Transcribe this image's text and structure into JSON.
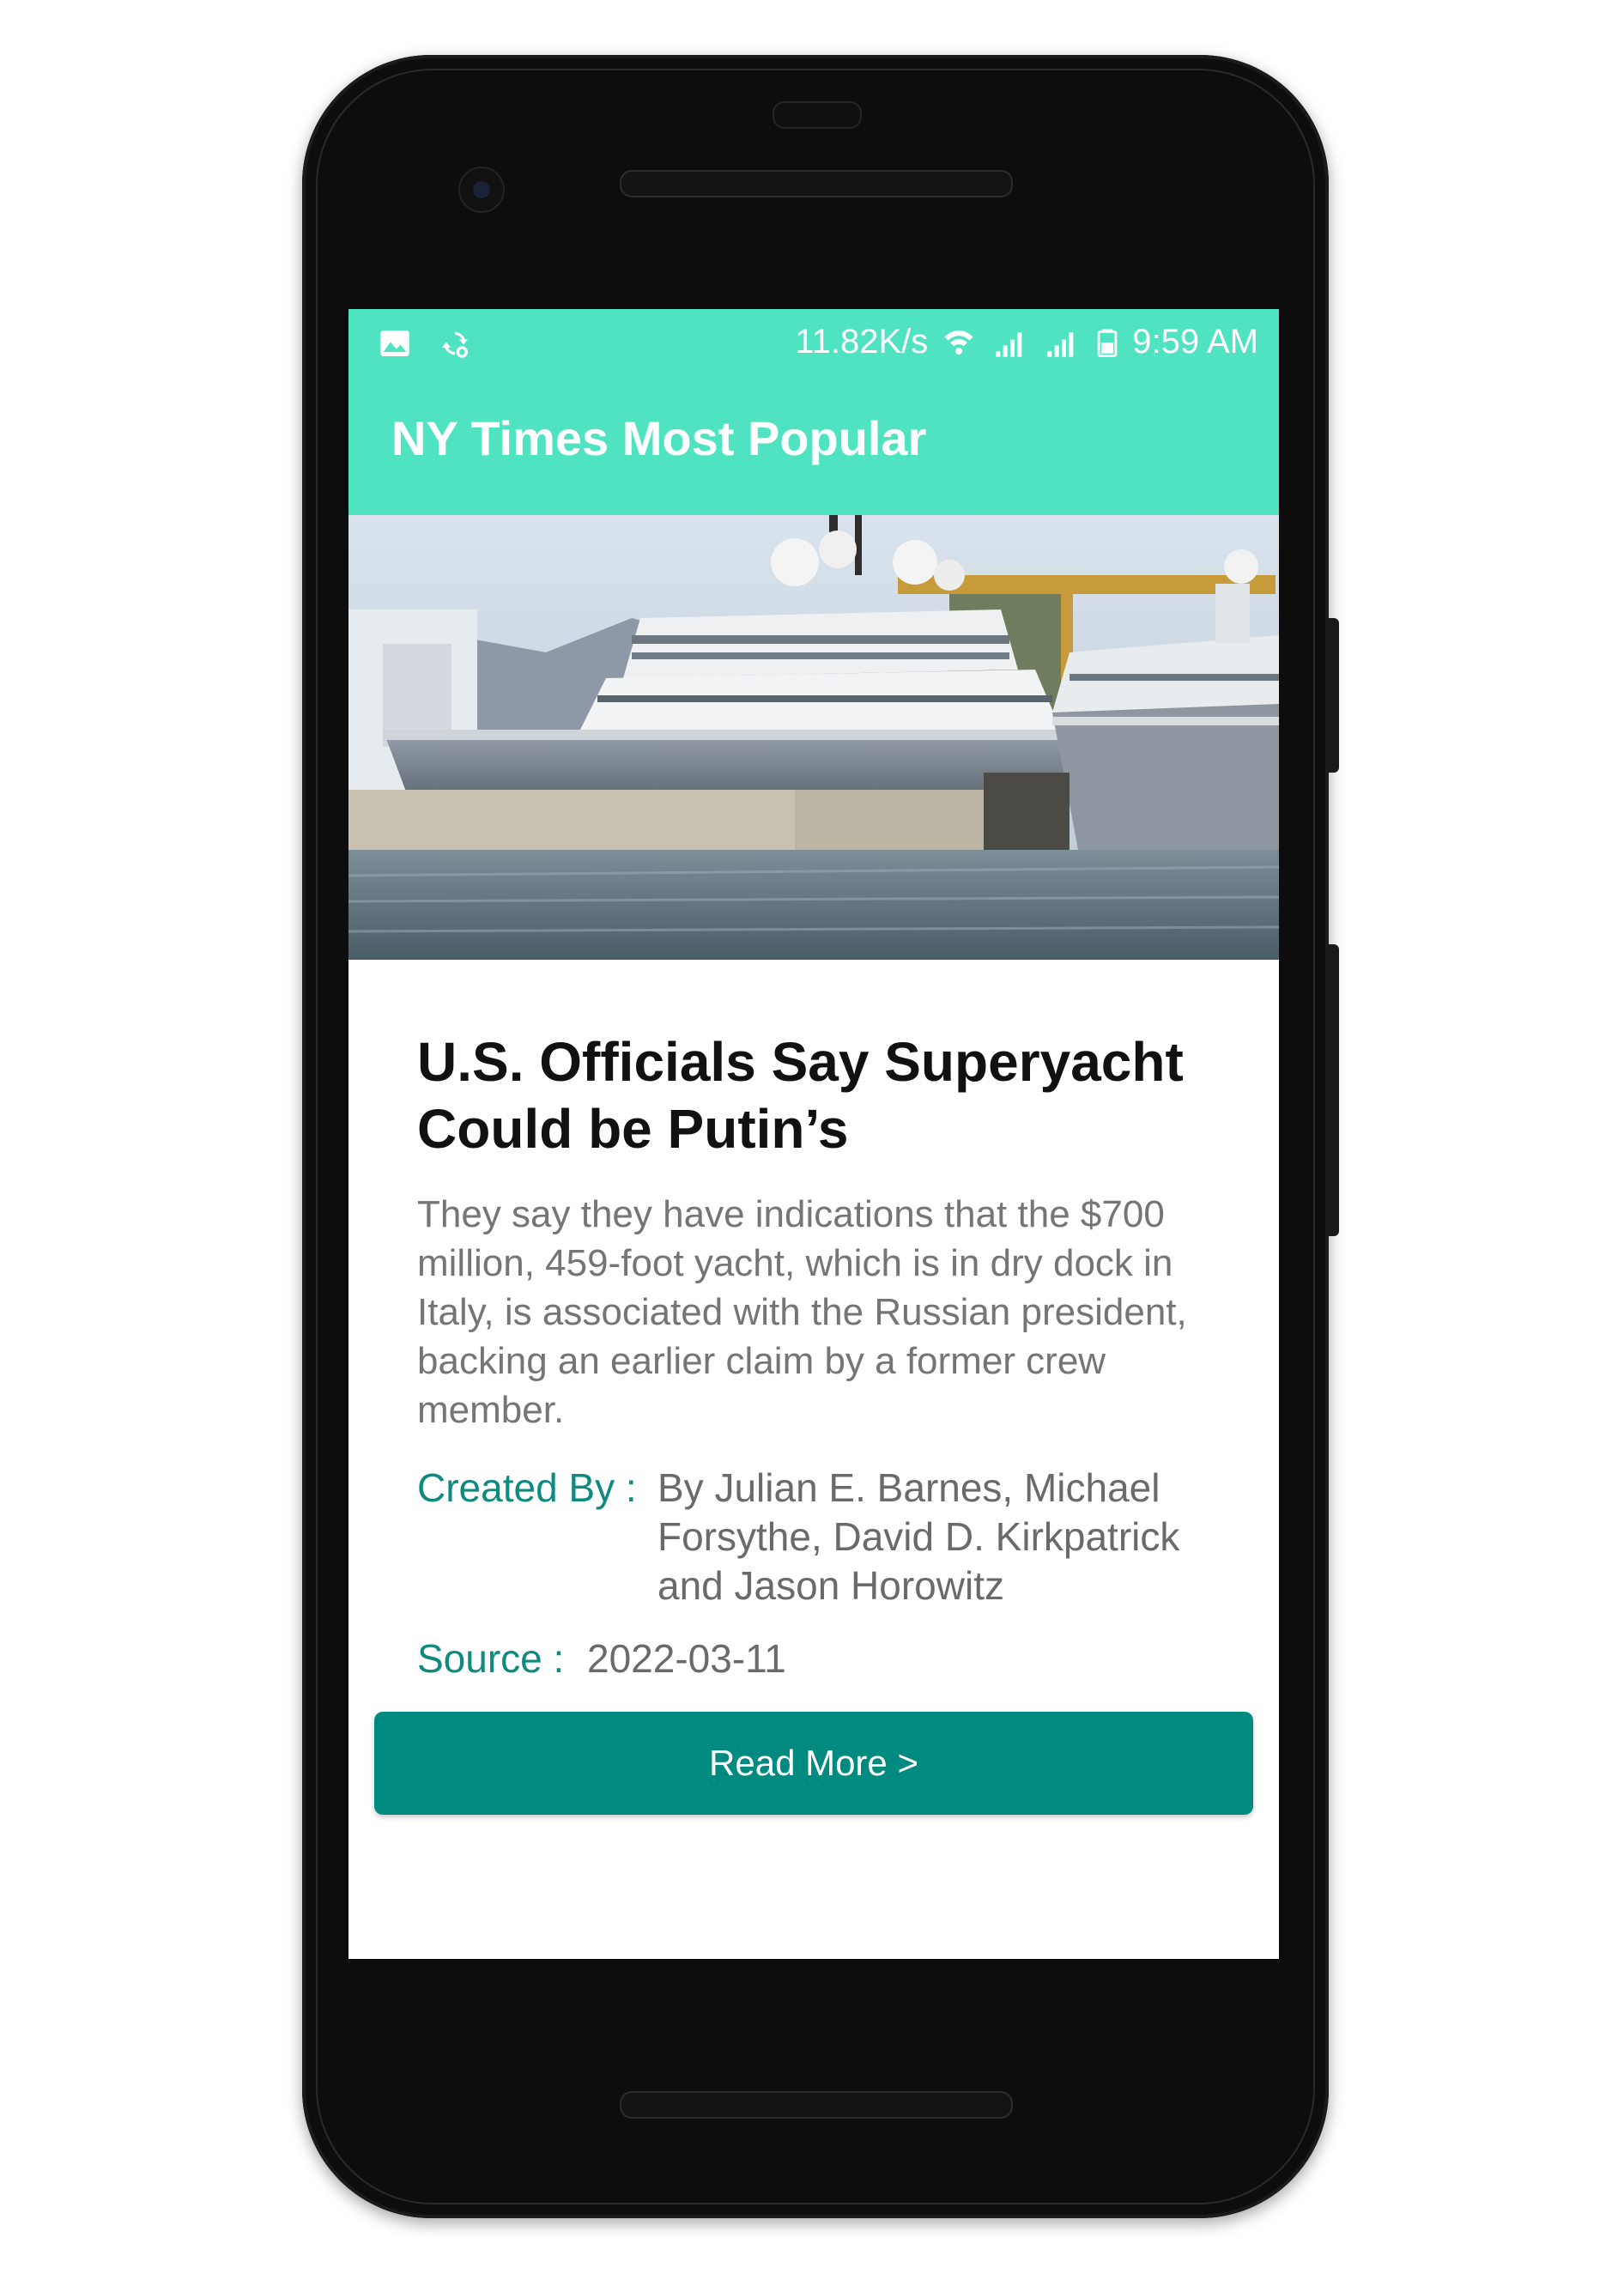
{
  "status_bar": {
    "net_speed": "11.82K/s",
    "time": "9:59 AM",
    "icons": [
      "image-icon",
      "sync-icon",
      "wifi-icon",
      "signal-icon",
      "signal-icon",
      "battery-icon"
    ]
  },
  "app_bar": {
    "title": "NY Times Most Popular",
    "color": "#4fe3c2"
  },
  "article": {
    "image": "superyacht-photo",
    "title": "U.S. Officials Say Superyacht Could be Putin’s",
    "abstract": "They say they have indications that the $700 million, 459-foot yacht, which is in dry dock in Italy, is associated with the Russian president, backing an earlier claim by a former crew member.",
    "created_by_label": "Created By :",
    "created_by_value": "By Julian E. Barnes, Michael Forsythe, David D. Kirkpatrick and Jason Horowitz",
    "source_label": "Source :",
    "source_value": "2022-03-11"
  },
  "read_more": {
    "label": "Read More >",
    "color": "#008a80"
  }
}
